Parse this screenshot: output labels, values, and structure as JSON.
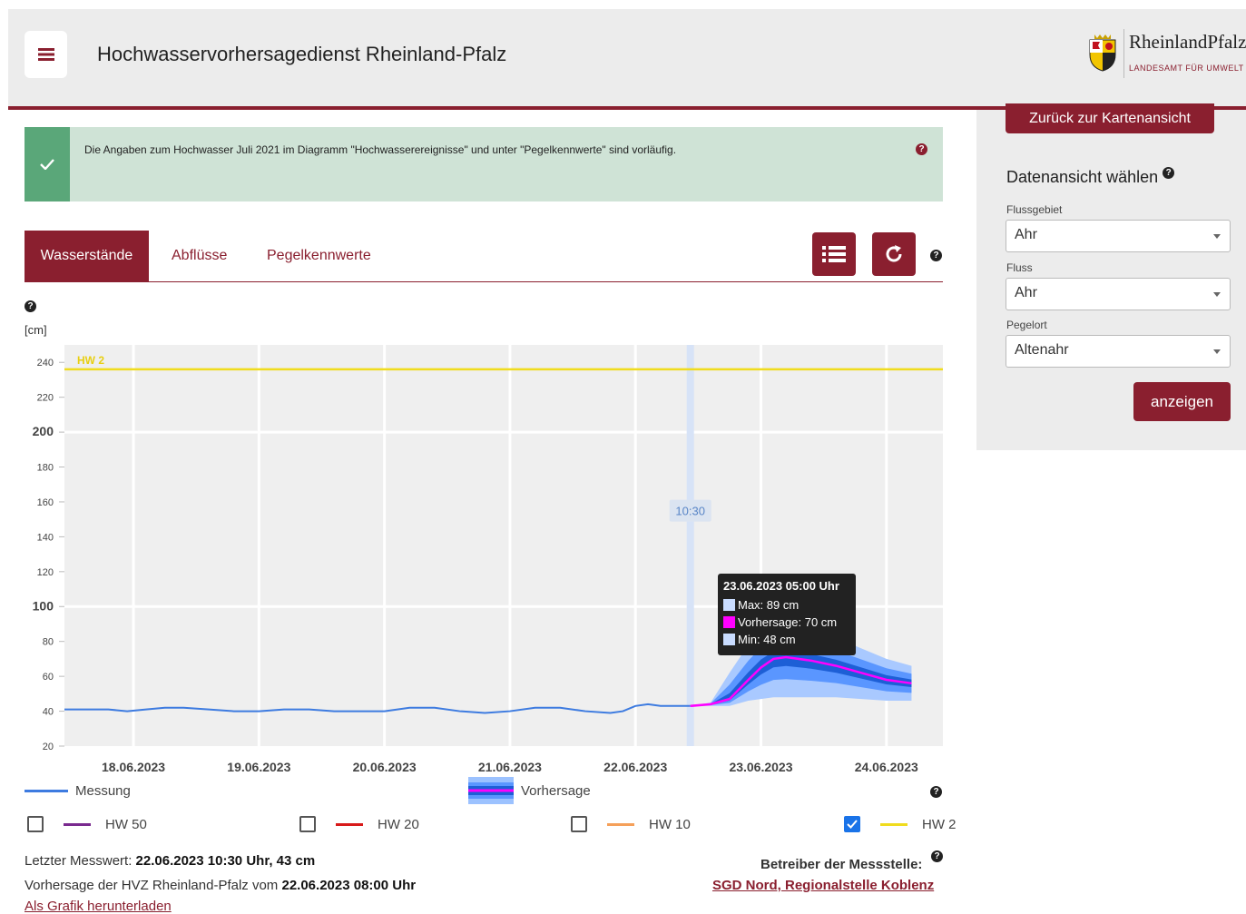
{
  "header": {
    "title": "Hochwasservorhersagedienst Rheinland-Pfalz",
    "logo_text": "RheinlandPfalz",
    "logo_sub": "LANDESAMT FÜR UMWELT",
    "menu_icon": "hamburger-icon"
  },
  "notice": {
    "text": "Die Angaben zum Hochwasser Juli 2021 im Diagramm \"Hochwasserereignisse\" und unter \"Pegelkennwerte\" sind vorläufig.",
    "icon": "check-icon",
    "help": "?"
  },
  "tabs": [
    {
      "label": "Wasserstände",
      "active": true
    },
    {
      "label": "Abflüsse",
      "active": false
    },
    {
      "label": "Pegelkennwerte",
      "active": false
    }
  ],
  "toolbar": {
    "list_icon": "list-icon",
    "refresh_icon": "refresh-icon",
    "help": "?"
  },
  "chart_help": "?",
  "chart_data": {
    "type": "line",
    "ylabel": "[cm]",
    "ylim": [
      20,
      250
    ],
    "yticks": [
      20,
      40,
      60,
      80,
      100,
      120,
      140,
      160,
      180,
      200,
      220,
      240
    ],
    "bold_yticks": [
      100,
      200
    ],
    "xlim": [
      17.45,
      24.45
    ],
    "xticks": [
      {
        "value": 18,
        "label": "18.06.2023"
      },
      {
        "value": 19,
        "label": "19.06.2023"
      },
      {
        "value": 20,
        "label": "20.06.2023"
      },
      {
        "value": 21,
        "label": "21.06.2023"
      },
      {
        "value": 22,
        "label": "22.06.2023"
      },
      {
        "value": 23,
        "label": "23.06.2023"
      },
      {
        "value": 24,
        "label": "24.06.2023"
      }
    ],
    "current_time": {
      "x": 22.4375,
      "label": "10:30"
    },
    "threshold": {
      "name": "HW 2",
      "value": 236,
      "color": "#f0dc1e"
    },
    "series": [
      {
        "name": "Messung",
        "color": "#3d7be0",
        "x": [
          17.45,
          17.6,
          17.8,
          17.95,
          18.1,
          18.25,
          18.4,
          18.6,
          18.8,
          19.0,
          19.2,
          19.4,
          19.6,
          19.8,
          20.0,
          20.2,
          20.4,
          20.6,
          20.8,
          21.0,
          21.2,
          21.4,
          21.6,
          21.8,
          21.9,
          22.0,
          22.1,
          22.2,
          22.3,
          22.4375
        ],
        "y": [
          41,
          41,
          41,
          40,
          41,
          42,
          42,
          41,
          40,
          40,
          41,
          41,
          40,
          40,
          40,
          42,
          42,
          40,
          39,
          40,
          42,
          42,
          40,
          39,
          40,
          43,
          44,
          43,
          43,
          43
        ]
      },
      {
        "name": "Vorhersage",
        "color": "#ff00ff",
        "x": [
          22.4375,
          22.6,
          22.75,
          22.9,
          23.0,
          23.1,
          23.2,
          23.4,
          23.6,
          23.8,
          24.0,
          24.2
        ],
        "y": [
          43,
          44,
          47,
          58,
          65,
          70,
          71,
          69,
          66,
          62,
          58,
          56
        ],
        "max": [
          43,
          45,
          62,
          78,
          86,
          89,
          89,
          86,
          82,
          76,
          70,
          66
        ],
        "min": [
          43,
          43,
          43,
          46,
          47,
          48,
          48,
          48,
          48,
          47,
          46,
          46
        ]
      }
    ],
    "tooltip": {
      "title": "23.06.2023 05:00 Uhr",
      "rows": [
        {
          "color": "#c9dcff",
          "text": "Max: 89 cm"
        },
        {
          "color": "#ff00ff",
          "text": "Vorhersage: 70 cm"
        },
        {
          "color": "#c9dcff",
          "text": "Min: 48 cm"
        }
      ]
    }
  },
  "legend": {
    "measurement": "Messung",
    "forecast": "Vorhersage",
    "help": "?",
    "thresholds": [
      {
        "label": "HW 50",
        "color": "#7a2a8f",
        "checked": false
      },
      {
        "label": "HW 20",
        "color": "#d81a1a",
        "checked": false
      },
      {
        "label": "HW 10",
        "color": "#f5a05a",
        "checked": false
      },
      {
        "label": "HW 2",
        "color": "#f0dc1e",
        "checked": true
      }
    ]
  },
  "info": {
    "last_label": "Letzter Messwert: ",
    "last_value": "22.06.2023 10:30 Uhr, 43 cm",
    "forecast_label": "Vorhersage der HVZ Rheinland-Pfalz vom ",
    "forecast_value": "22.06.2023 08:00 Uhr",
    "download": "Als Grafik herunterladen",
    "operator_label": "Betreiber der Messstelle:",
    "operator_link": "SGD Nord, Regionalstelle Koblenz",
    "help": "?"
  },
  "sidebar": {
    "back": "Zurück zur Kartenansicht",
    "title": "Datenansicht wählen",
    "help": "?",
    "fields": [
      {
        "label": "Flussgebiet",
        "value": "Ahr"
      },
      {
        "label": "Fluss",
        "value": "Ahr"
      },
      {
        "label": "Pegelort",
        "value": "Altenahr"
      }
    ],
    "submit": "anzeigen"
  }
}
